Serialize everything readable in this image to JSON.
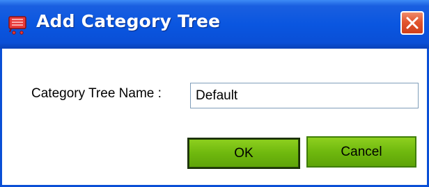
{
  "window": {
    "title": "Add Category Tree",
    "app_icon": "cart-icon",
    "close_icon": "close-icon"
  },
  "form": {
    "name_label": "Category Tree Name :",
    "name_value": "Default"
  },
  "buttons": {
    "ok_label": "OK",
    "cancel_label": "Cancel"
  },
  "colors": {
    "titlebar": "#0a56e0",
    "close": "#e2552e",
    "button_green": "#6fb80e"
  }
}
